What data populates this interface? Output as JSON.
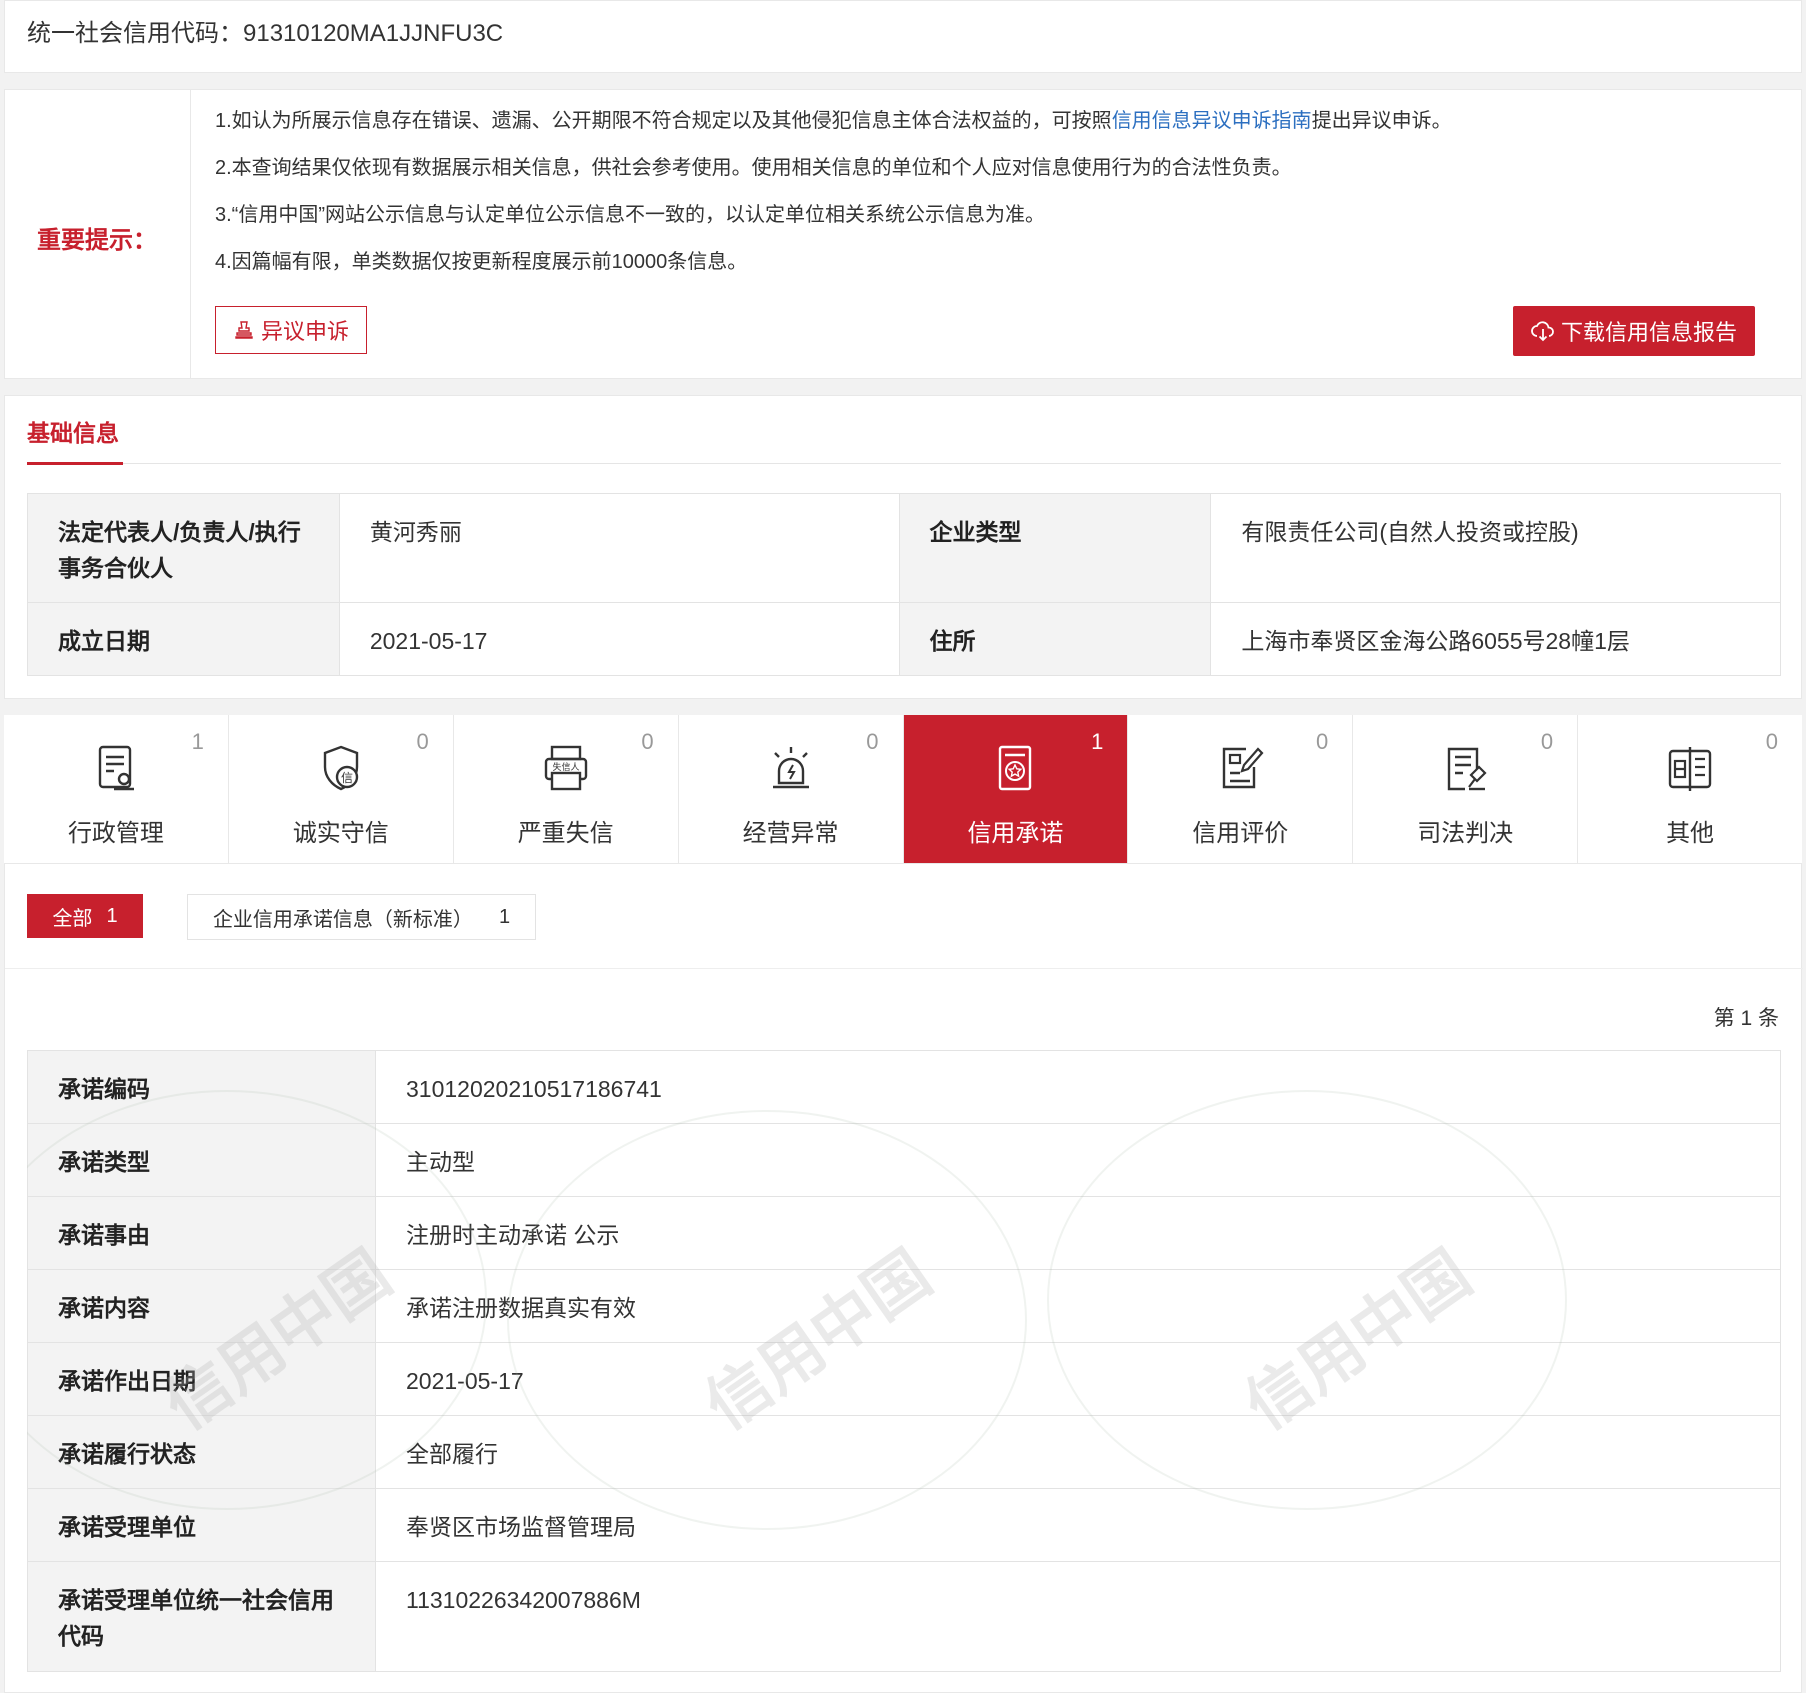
{
  "credit_code_line": "统一社会信用代码：91310120MA1JJNFU3C",
  "notice": {
    "label": "重要提示：",
    "line1_before": "1.如认为所展示信息存在错误、遗漏、公开期限不符合规定以及其他侵犯信息主体合法权益的，可按照",
    "line1_link": "信用信息异议申诉指南",
    "line1_after": "提出异议申诉。",
    "line2": "2.本查询结果仅依现有数据展示相关信息，供社会参考使用。使用相关信息的单位和个人应对信息使用行为的合法性负责。",
    "line3": "3.“信用中国”网站公示信息与认定单位公示信息不一致的，以认定单位相关系统公示信息为准。",
    "line4": "4.因篇幅有限，单类数据仅按更新程度展示前10000条信息。",
    "objection_button": "异议申诉",
    "download_button": "下载信用信息报告"
  },
  "basic_info": {
    "title": "基础信息",
    "rows": [
      {
        "label1": "法定代表人/负责人/执行事务合伙人",
        "value1": "黄河秀丽",
        "label2": "企业类型",
        "value2": "有限责任公司(自然人投资或控股)"
      },
      {
        "label1": "成立日期",
        "value1": "2021-05-17",
        "label2": "住所",
        "value2": "上海市奉贤区金海公路6055号28幢1层"
      }
    ]
  },
  "tabs": [
    {
      "label": "行政管理",
      "count": "1",
      "icon": "admin-doc-icon"
    },
    {
      "label": "诚实守信",
      "count": "0",
      "icon": "shield-xin-icon"
    },
    {
      "label": "严重失信",
      "count": "0",
      "icon": "printer-shixinren-icon"
    },
    {
      "label": "经营异常",
      "count": "0",
      "icon": "alarm-siren-icon"
    },
    {
      "label": "信用承诺",
      "count": "1",
      "icon": "star-document-icon",
      "active": true
    },
    {
      "label": "信用评价",
      "count": "0",
      "icon": "edit-document-icon"
    },
    {
      "label": "司法判决",
      "count": "0",
      "icon": "gavel-document-icon"
    },
    {
      "label": "其他",
      "count": "0",
      "icon": "grid-book-icon"
    }
  ],
  "filters": {
    "all_label": "全部",
    "all_count": "1",
    "sub_label": "企业信用承诺信息（新标准）",
    "sub_count": "1"
  },
  "record_index": "第 1 条",
  "record": [
    {
      "label": "承诺编码",
      "value": "310120202105171867​41"
    },
    {
      "label": "承诺类型",
      "value": "主动型"
    },
    {
      "label": "承诺事由",
      "value": "注册时主动承诺 公示"
    },
    {
      "label": "承诺内容",
      "value": "承诺注册数据真实有效"
    },
    {
      "label": "承诺作出日期",
      "value": "2021-05-17"
    },
    {
      "label": "承诺履行状态",
      "value": "全部履行"
    },
    {
      "label": "承诺受理单位",
      "value": "奉贤区市场监督管理局"
    },
    {
      "label": "承诺受理单位统一社会信用代码",
      "value": "11310226342007886M"
    }
  ],
  "watermark_text": "信用中国",
  "colors": {
    "accent": "#c7202d",
    "link": "#2c6fc0"
  }
}
